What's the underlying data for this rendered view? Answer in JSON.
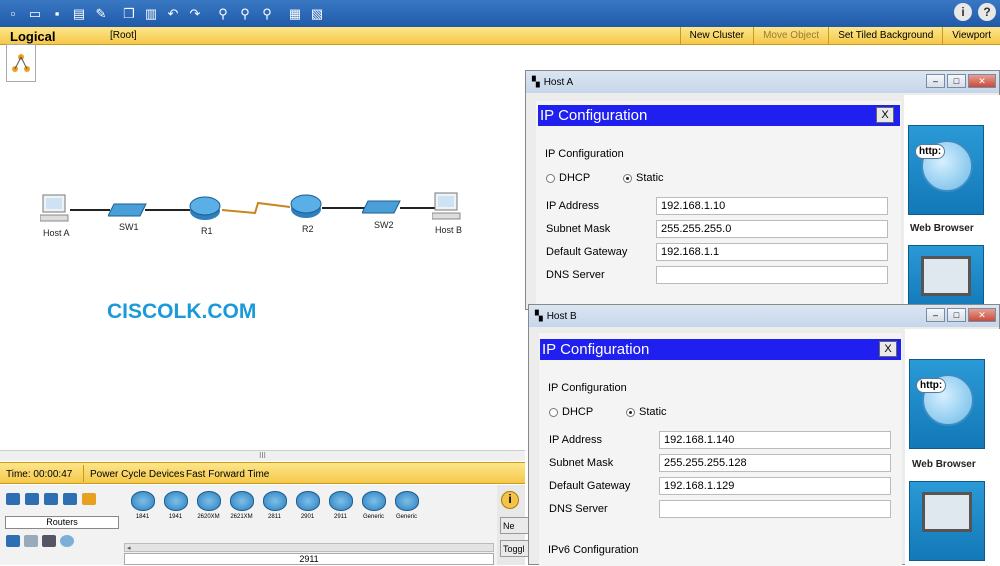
{
  "toolbar": {
    "icons": [
      "new-file-icon",
      "open-folder-icon",
      "save-icon",
      "print-icon",
      "activity-wizard-icon",
      "copy-icon",
      "paste-icon",
      "undo-icon",
      "redo-icon",
      "zoom-in-icon",
      "zoom-reset-icon",
      "zoom-out-icon",
      "palette-icon",
      "custom-device-icon"
    ],
    "info_glyph": "i",
    "help_glyph": "?"
  },
  "modebar": {
    "logical": "Logical",
    "root": "[Root]",
    "new_cluster": "New Cluster",
    "move_object": "Move Object",
    "tiled_bg": "Set Tiled Background",
    "viewport": "Viewport"
  },
  "topology": {
    "devices": {
      "host_a": "Host A",
      "sw1": "SW1",
      "r1": "R1",
      "r2": "R2",
      "sw2": "SW2",
      "host_b": "Host B"
    }
  },
  "watermark": "CISCOLK.COM",
  "status": {
    "time": "Time: 00:00:47",
    "power": "Power Cycle Devices",
    "fast_forward": "Fast Forward Time",
    "scroll_glyph": "III"
  },
  "device_panel": {
    "category_label": "Routers",
    "models": [
      "1841",
      "1941",
      "2620XM",
      "2621XM",
      "2811",
      "2901",
      "2911",
      "Generic",
      "Generic"
    ],
    "selected_model": "2911",
    "side_btn_new": "Ne",
    "side_btn_toggle": "Toggl"
  },
  "host_a": {
    "title": "Host A",
    "header": "IP Configuration",
    "close": "X",
    "group": "IP Configuration",
    "dhcp": "DHCP",
    "static": "Static",
    "labels": {
      "ip": "IP Address",
      "mask": "Subnet Mask",
      "gateway": "Default Gateway",
      "dns": "DNS Server"
    },
    "values": {
      "ip": "192.168.1.10",
      "mask": "255.255.255.0",
      "gateway": "192.168.1.1",
      "dns": ""
    },
    "app_http": "http:",
    "app_web": "Web Browser"
  },
  "host_b": {
    "title": "Host B",
    "header": "IP Configuration",
    "close": "X",
    "group": "IP Configuration",
    "dhcp": "DHCP",
    "static": "Static",
    "labels": {
      "ip": "IP Address",
      "mask": "Subnet Mask",
      "gateway": "Default Gateway",
      "dns": "DNS Server"
    },
    "values": {
      "ip": "192.168.1.140",
      "mask": "255.255.255.128",
      "gateway": "192.168.1.129",
      "dns": ""
    },
    "ipv6": "IPv6 Configuration",
    "app_http": "http:",
    "app_web": "Web Browser"
  },
  "colors": {
    "accent_blue": "#1f1ff0",
    "modebar": "#f5c84a",
    "watermark": "#1a9ad9"
  }
}
